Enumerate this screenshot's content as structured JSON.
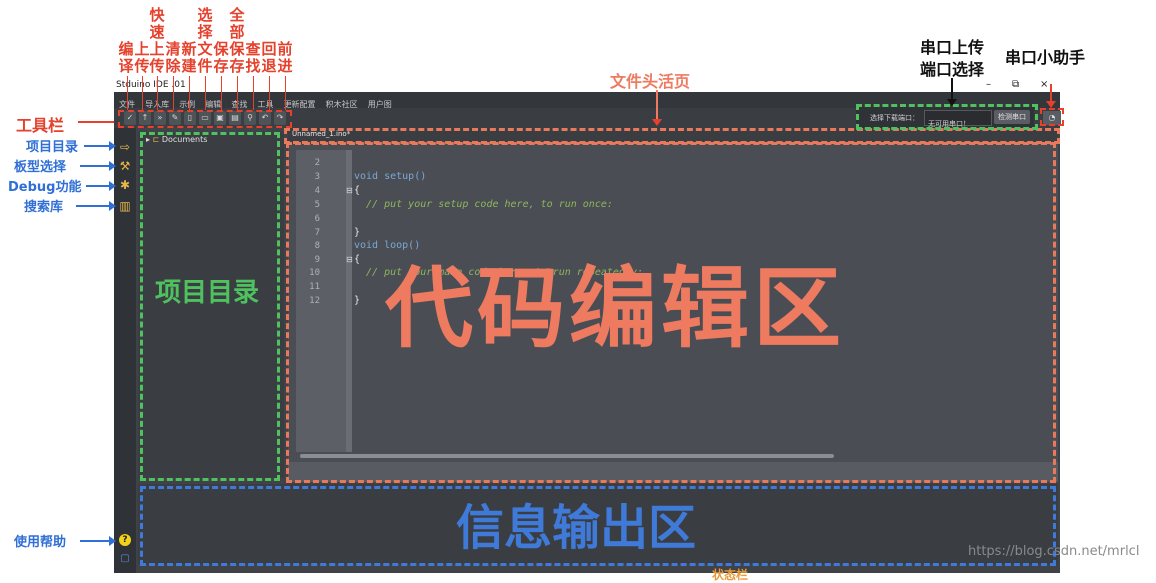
{
  "window": {
    "title": "Stduino IDE .01",
    "controls": [
      "–",
      "⧉",
      "×"
    ]
  },
  "menu": [
    "文件",
    "导入库",
    "示例",
    "编辑",
    "查找",
    "工具",
    "更新配置",
    "积木社区",
    "用户图"
  ],
  "editor": {
    "tab_label": "Unnamed_1.ino*",
    "lines": [
      {
        "n": "2",
        "text": ""
      },
      {
        "n": "3",
        "text": "void setup()"
      },
      {
        "n": "4",
        "text": "{"
      },
      {
        "n": "5",
        "text": "  // put your setup code here, to run once:"
      },
      {
        "n": "6",
        "text": ""
      },
      {
        "n": "7",
        "text": "}"
      },
      {
        "n": "8",
        "text": "void loop()"
      },
      {
        "n": "9",
        "text": "{"
      },
      {
        "n": "10",
        "text": "  // put your main code here, to run repeatedly:"
      },
      {
        "n": "11",
        "text": ""
      },
      {
        "n": "12",
        "text": "}"
      }
    ]
  },
  "project_tree": {
    "root": "Documents"
  },
  "port": {
    "label": "选择下载端口：",
    "selected": "无可用串口！",
    "button": "检测串口"
  },
  "help_icon": "?",
  "annotations": {
    "toolbar_caption": "工具栏",
    "toolbar_items": [
      "编译",
      "上传",
      "快速上传",
      "清除",
      "新建",
      "选择文件",
      "保存",
      "全部保存",
      "查找",
      "回退",
      "前进"
    ],
    "tb_col1": "编\n译",
    "tb_col2": "上\n传",
    "tb_col3": "快\n速\n上\n传",
    "tb_col4": "清\n除",
    "tb_col5": "新\n建",
    "tb_col6": "选\n择\n文\n件",
    "tb_col7": "保\n存",
    "tb_col8": "全\n部\n保\n存",
    "tb_col9": "查\n找",
    "tb_col10": "回\n退",
    "tb_col11": "前\n进",
    "file_tab_caption": "文件头活页",
    "serial_upload_caption_l1": "串口上传",
    "serial_upload_caption_l2": "端口选择",
    "serial_helper_caption": "串口小助手",
    "left_project_dir": "项目目录",
    "left_board_select": "板型选择",
    "left_debug": "Debug功能",
    "left_search_lib": "搜索库",
    "left_help": "使用帮助",
    "area_project": "项目目录",
    "area_code": "代码编辑区",
    "area_output": "信息输出区",
    "status_peek": "状态栏"
  },
  "watermark": "https://blog.csdn.net/mrlcl",
  "colors": {
    "green_dash": "#4fc25f",
    "orange_dash": "#e8795b",
    "blue_dash": "#3f7ad9",
    "red_label": "#e5412d",
    "blue_label": "#2f6fd6"
  },
  "icons": [
    "compile-icon",
    "upload-icon",
    "fast-upload-icon",
    "clean-icon",
    "new-file-icon",
    "open-file-icon",
    "save-icon",
    "save-all-icon",
    "find-icon",
    "undo-icon",
    "redo-icon",
    "project-dir-icon",
    "board-select-icon",
    "debug-icon",
    "search-library-icon",
    "help-icon",
    "chat-icon",
    "serial-helper-icon"
  ]
}
